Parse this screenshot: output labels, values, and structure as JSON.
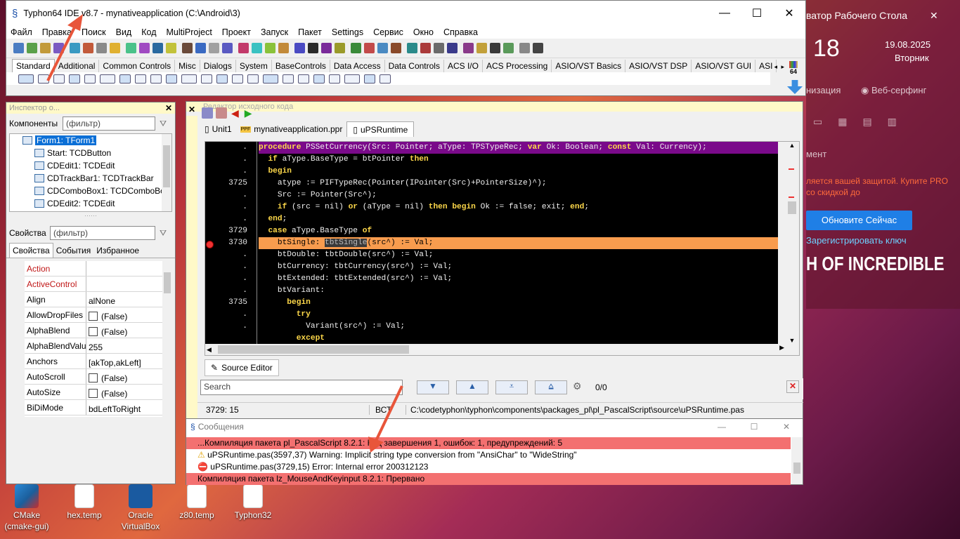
{
  "app": {
    "title": "Typhon64 IDE v8.7 - mynativeapplication (C:\\Android\\3)",
    "min": "—",
    "max": "☐",
    "close": "✕"
  },
  "menu": [
    "Файл",
    "Правка",
    "Поиск",
    "Вид",
    "Код",
    "MultiProject",
    "Проект",
    "Запуск",
    "Пакет",
    "Settings",
    "Сервис",
    "Окно",
    "Справка"
  ],
  "palette": {
    "tabs": [
      "Standard",
      "Additional",
      "Common Controls",
      "Misc",
      "Dialogs",
      "System",
      "BaseControls",
      "Data Access",
      "Data Controls",
      "ACS I/O",
      "ACS Processing",
      "ASIO/VST Basics",
      "ASIO/VST DSP",
      "ASIO/VST GUI",
      "ASI"
    ],
    "badge": "64"
  },
  "desktop": {
    "bg_title": "ватор Рабочего Стола",
    "close": "✕",
    "clock": "18",
    "date": "19.08.2025",
    "weekday": "Вторник",
    "link1": "низация",
    "link2": "Веб-серфинг",
    "section": "мент",
    "promo": "ляется вашей защитой. Купите PRO со скидкой до",
    "update_btn": "Обновите Сейчас",
    "register": "Зарегистрировать ключ",
    "slogan": "H OF INCREDIBLE",
    "icons": [
      {
        "label": "CMake (cmake-gui)",
        "color": "#1b5e9c"
      },
      {
        "label": "hex.temp",
        "color": "#ffffff"
      },
      {
        "label": "Oracle VirtualBox",
        "color": "#1a5aa0"
      },
      {
        "label": "z80.temp",
        "color": "#ffffff"
      },
      {
        "label": "Typhon32",
        "color": "#ffffff"
      }
    ]
  },
  "inspector": {
    "title": "Инспектор о...",
    "close": "✕",
    "components_label": "Компоненты",
    "filter_placeholder": "(фильтр)",
    "tree": [
      "Form1: TForm1",
      "Start: TCDButton",
      "CDEdit1: TCDEdit",
      "CDTrackBar1: TCDTrackBar",
      "CDComboBox1: TCDComboBox",
      "CDEdit2: TCDEdit"
    ],
    "props_label": "Свойства",
    "tabs": [
      "Свойства",
      "События",
      "Избранное"
    ],
    "props": [
      {
        "name": "Action",
        "value": "",
        "red": true
      },
      {
        "name": "ActiveControl",
        "value": "",
        "red": true
      },
      {
        "name": "Align",
        "value": "alNone"
      },
      {
        "name": "AllowDropFiles",
        "value": "(False)",
        "check": true
      },
      {
        "name": "AlphaBlend",
        "value": "(False)",
        "check": true
      },
      {
        "name": "AlphaBlendValu",
        "value": "255"
      },
      {
        "name": "Anchors",
        "value": "[akTop,akLeft]",
        "expand": "›"
      },
      {
        "name": "AutoScroll",
        "value": "(False)",
        "check": true
      },
      {
        "name": "AutoSize",
        "value": "(False)",
        "check": true
      },
      {
        "name": "BiDiMode",
        "value": "bdLeftToRight"
      }
    ]
  },
  "editor": {
    "title": "Редактор исходного кода",
    "close": "✕",
    "tabs": [
      "Unit1",
      "mynativeapplication.ppr",
      "uPSRuntime"
    ],
    "tab_prefix": "PPF",
    "gutter": [
      ".",
      ".",
      ".",
      "3725",
      ".",
      ".",
      ".",
      "3729",
      "3730",
      ".",
      ".",
      ".",
      ".",
      "3735",
      ".",
      "."
    ],
    "code": [
      "procedure PSSetCurrency(Src: Pointer; aType: TPSTypeRec; var Ok: Boolean; const Val: Currency);",
      "  if aType.BaseType = btPointer then",
      "  begin",
      "    atype := PIFTypeRec(Pointer(IPointer(Src)+PointerSize)^);",
      "    Src := Pointer(Src^);",
      "    if (src = nil) or (aType = nil) then begin Ok := false; exit; end;",
      "  end;",
      "  case aType.BaseType of",
      "    btSingle: tbtSingle(src^) := Val;",
      "    btDouble: tbtDouble(src^) := Val;",
      "    btCurrency: tbtCurrency(src^) := Val;",
      "    btExtended: tbtExtended(src^) := Val;",
      "    btVariant:",
      "      begin",
      "        try",
      "          Variant(src^) := Val;",
      "        except"
    ],
    "source_tab": "Source Editor",
    "search_placeholder": "Search",
    "search_count": "0/0",
    "status": {
      "pos": "3729: 15",
      "mode": "ВСТ",
      "path": "C:\\codetyphon\\typhon\\components\\packages_pl\\pl_PascalScript\\source\\uPSRuntime.pas"
    }
  },
  "messages": {
    "title": "Сообщения",
    "min": "—",
    "max": "☐",
    "close": "✕",
    "lines": [
      {
        "text": "...Компиляция пакета pl_PascalScript 8.2.1: Код завершения 1, ошибок: 1, предупреждений: 5",
        "style": "red"
      },
      {
        "text": "uPSRuntime.pas(3597,37) Warning: Implicit string type conversion from \"AnsiChar\" to \"WideString\"",
        "style": "warn"
      },
      {
        "text": "uPSRuntime.pas(3729,15) Error: Internal error 200312123",
        "style": "err"
      },
      {
        "text": "Компиляция пакета lz_MouseAndKeyinput 8.2.1: Прервано",
        "style": "red"
      }
    ]
  },
  "colors": {
    "accent": "#0b6fd6",
    "error_line": "#f89c4e",
    "message_red": "#f37070",
    "selection": "#3b7ee0"
  }
}
